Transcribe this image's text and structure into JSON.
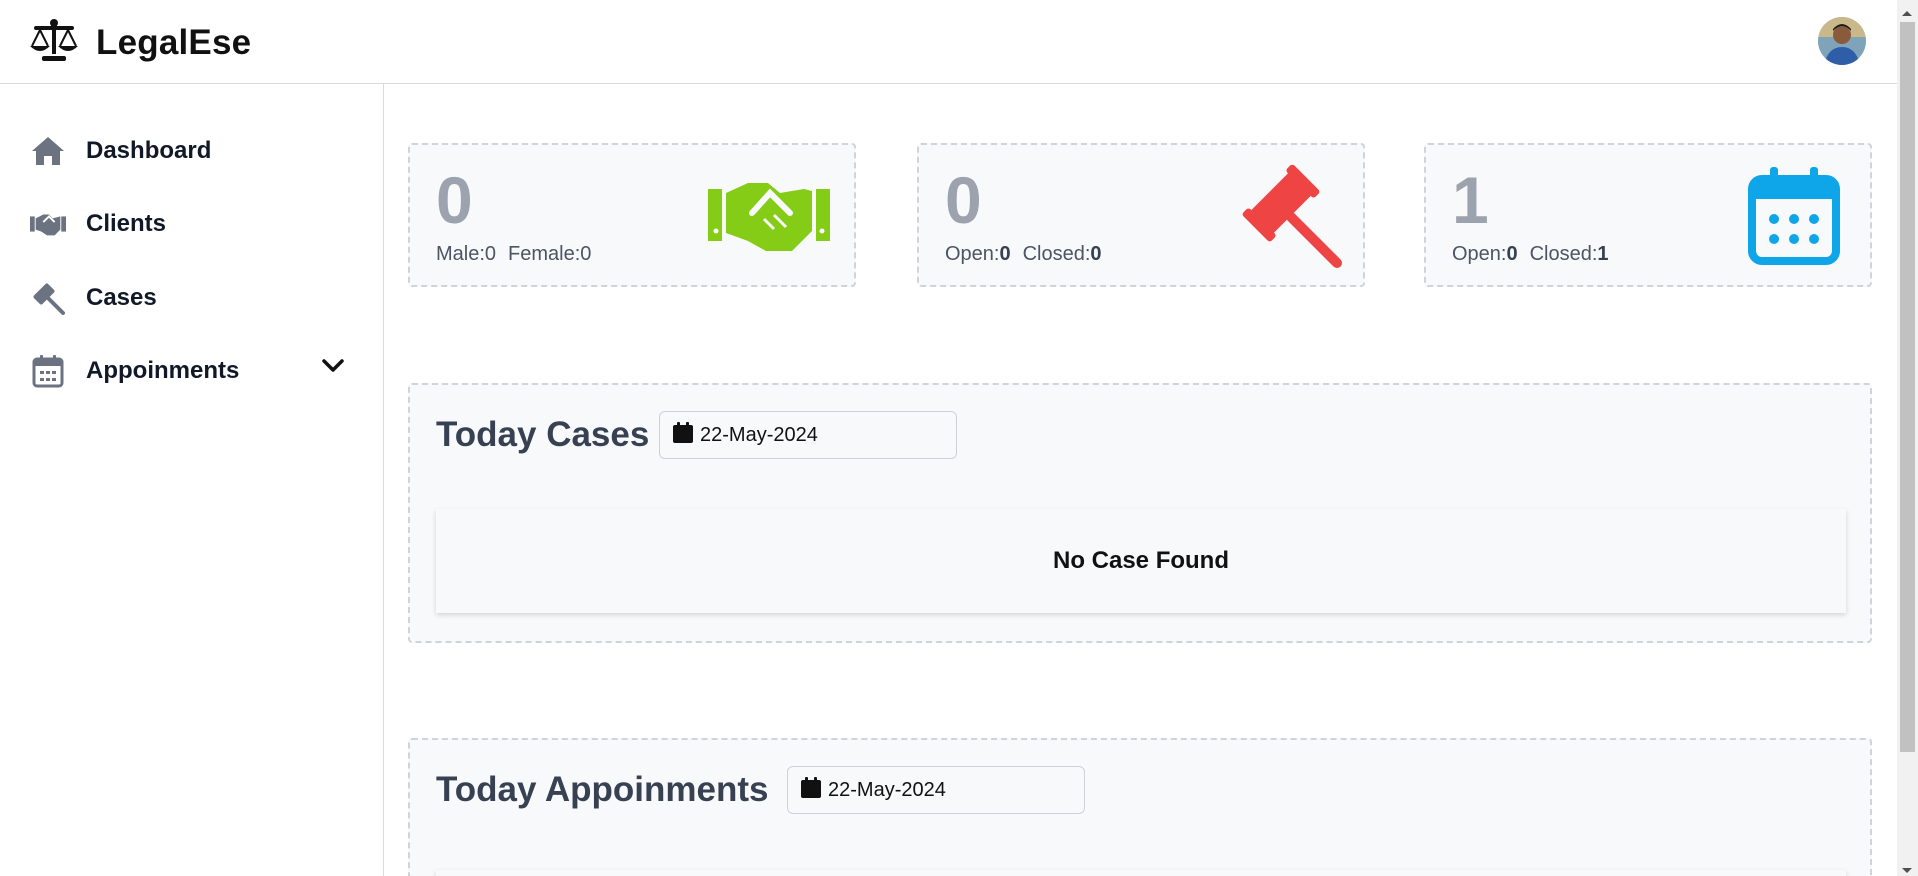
{
  "brand": {
    "name": "LegalEse",
    "logo_icon": "scales-of-justice-icon"
  },
  "user": {
    "avatar_icon": "user-avatar"
  },
  "sidebar": {
    "items": [
      {
        "label": "Dashboard",
        "icon": "home-icon"
      },
      {
        "label": "Clients",
        "icon": "handshake-icon"
      },
      {
        "label": "Cases",
        "icon": "gavel-icon"
      },
      {
        "label": "Appoinments",
        "icon": "calendar-icon",
        "has_submenu": true
      }
    ]
  },
  "stats": {
    "clients": {
      "count": "0",
      "male_label": "Male:",
      "male_value": "0",
      "female_label": "Female:",
      "female_value": "0",
      "icon": "handshake-icon",
      "color": "#84cc16"
    },
    "cases": {
      "count": "0",
      "open_label": "Open:",
      "open_value": "0",
      "closed_label": "Closed:",
      "closed_value": "0",
      "icon": "gavel-icon",
      "color": "#ef4444"
    },
    "appointments": {
      "count": "1",
      "open_label": "Open:",
      "open_value": "0",
      "closed_label": "Closed:",
      "closed_value": "1",
      "icon": "calendar-icon",
      "color": "#0ea5e9"
    }
  },
  "today_cases": {
    "title": "Today Cases",
    "date": "22-May-2024",
    "empty_text": "No Case Found"
  },
  "today_appointments": {
    "title": "Today Appoinments",
    "date": "22-May-2024"
  }
}
